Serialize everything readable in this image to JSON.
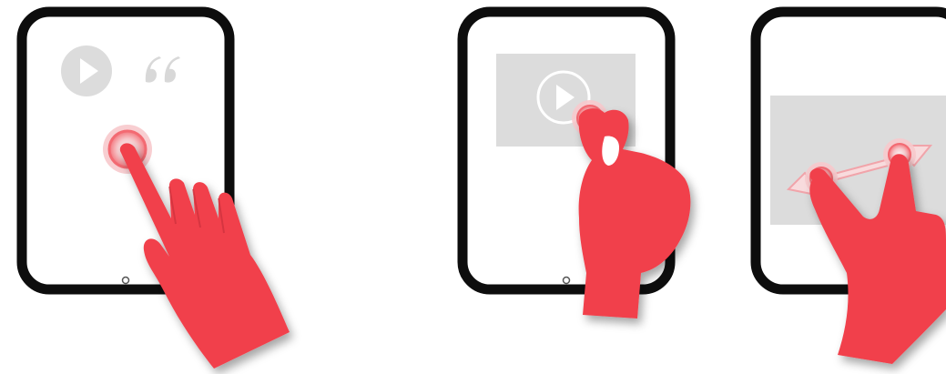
{
  "colors": {
    "background": "#ffffff",
    "tablet_frame": "#0d0d0d",
    "screen": "#ffffff",
    "hand": "#f1404c",
    "hand_shadow": "#b02a34",
    "touch_ring": "#f7c9cc",
    "touch_core": "#f36a72",
    "icon_gray": "#dcdcdc",
    "media_block": "#dcdcdc",
    "stretch_bar": "#f8dbdd"
  },
  "panels": [
    {
      "gesture": "tap",
      "screen_icons": [
        "play-icon",
        "quote-icon"
      ]
    },
    {
      "gesture": "pinch",
      "screen_icons": [
        "video-block",
        "play-icon"
      ]
    },
    {
      "gesture": "spread",
      "screen_icons": [
        "image-block",
        "double-arrow-icon"
      ]
    }
  ]
}
